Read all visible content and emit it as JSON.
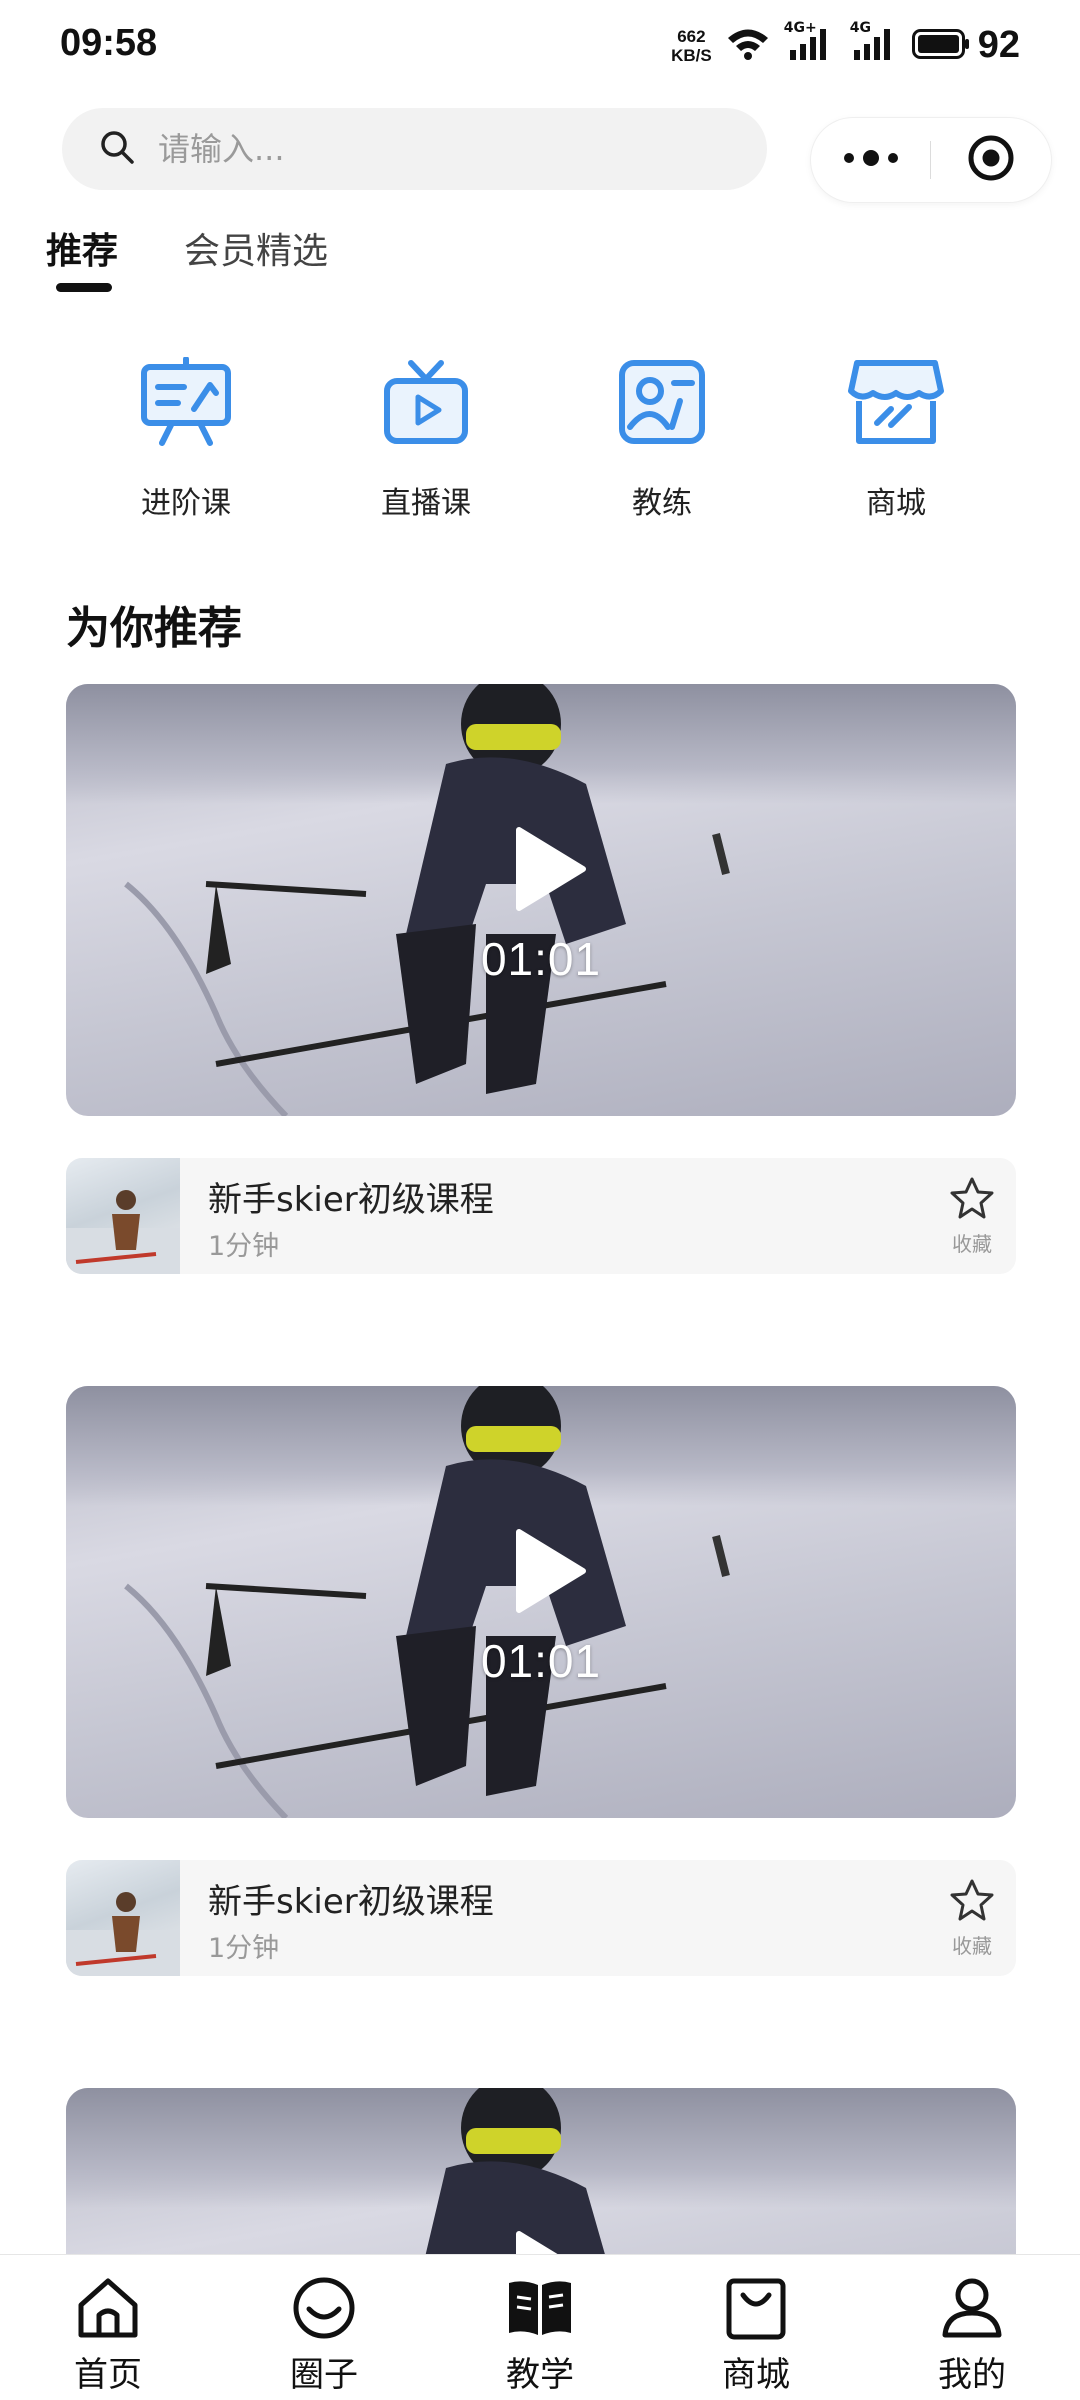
{
  "status_bar": {
    "time": "09:58",
    "net_speed_value": "662",
    "net_speed_unit": "KB/S",
    "signal1_label": "4G+",
    "signal2_label": "4G",
    "battery": "92"
  },
  "search": {
    "placeholder": "请输入..."
  },
  "capsule": {
    "more_icon": "more-dots-icon",
    "close_icon": "target-icon"
  },
  "tabs": [
    {
      "label": "推荐",
      "active": true
    },
    {
      "label": "会员精选",
      "active": false
    }
  ],
  "categories": [
    {
      "label": "进阶课",
      "icon": "presentation-icon"
    },
    {
      "label": "直播课",
      "icon": "tv-icon"
    },
    {
      "label": "教练",
      "icon": "coach-card-icon"
    },
    {
      "label": "商城",
      "icon": "store-icon"
    }
  ],
  "section_title": "为你推荐",
  "videos": [
    {
      "duration": "01:01",
      "title": "新手skier初级课程",
      "length": "1分钟",
      "fav_label": "收藏"
    },
    {
      "duration": "01:01",
      "title": "新手skier初级课程",
      "length": "1分钟",
      "fav_label": "收藏"
    },
    {
      "duration": "",
      "title": "",
      "length": "",
      "fav_label": ""
    }
  ],
  "bottom_nav": [
    {
      "label": "首页",
      "icon": "home-icon"
    },
    {
      "label": "圈子",
      "icon": "chat-bubble-icon"
    },
    {
      "label": "教学",
      "icon": "book-icon",
      "active": true
    },
    {
      "label": "商城",
      "icon": "shopping-bag-icon"
    },
    {
      "label": "我的",
      "icon": "user-icon"
    }
  ],
  "colors": {
    "accent_blue": "#3b8ee8",
    "text_dark": "#111111",
    "text_muted": "#999999"
  }
}
